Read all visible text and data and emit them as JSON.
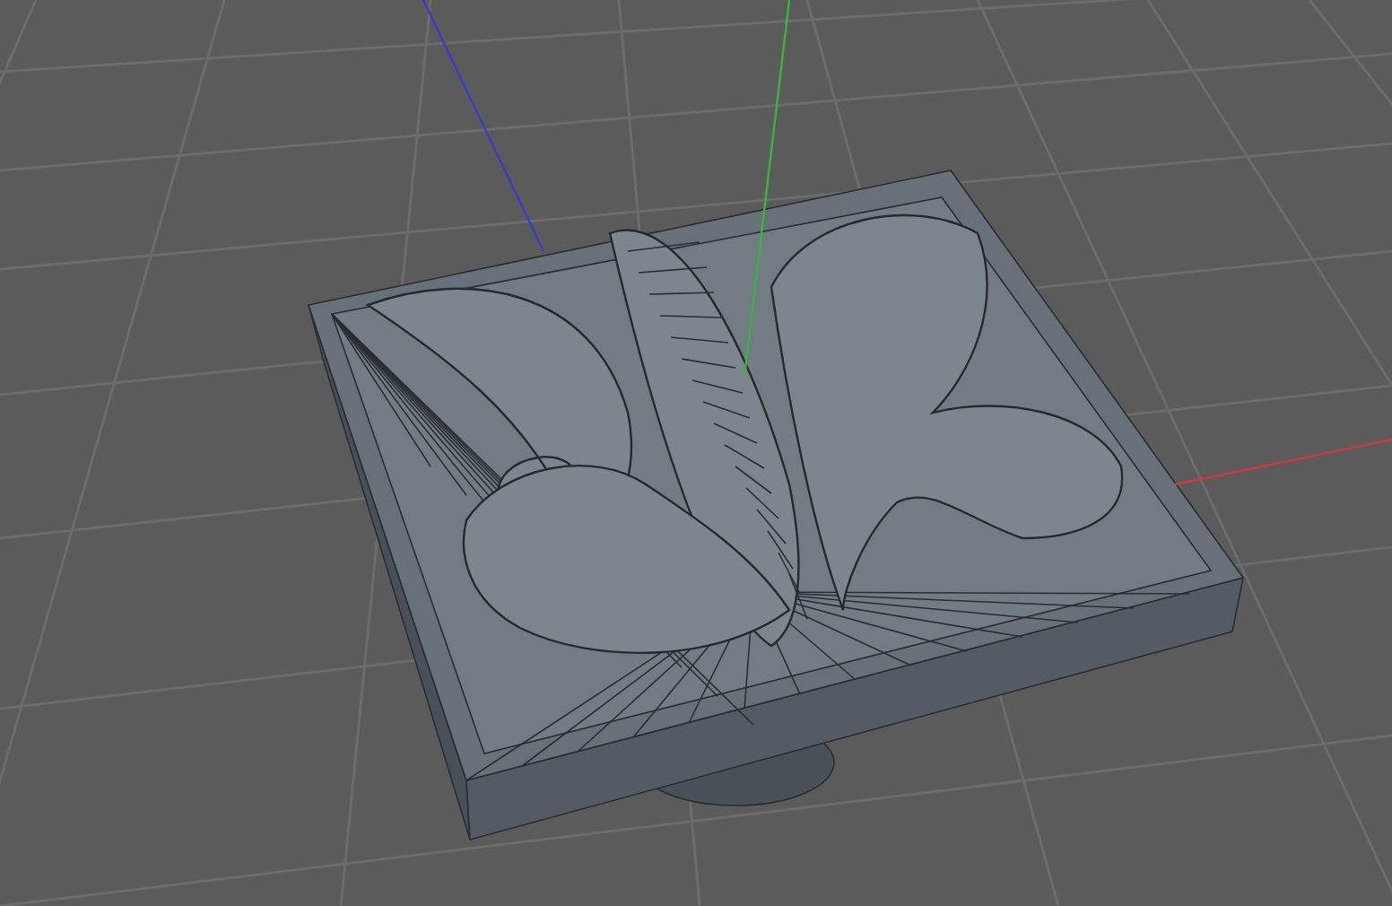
{
  "viewport": {
    "axes": [
      {
        "kind": "x",
        "color": "#c83c3c"
      },
      {
        "kind": "y",
        "color": "#3cb43c"
      },
      {
        "kind": "z",
        "color": "#3c3cc8"
      }
    ]
  }
}
